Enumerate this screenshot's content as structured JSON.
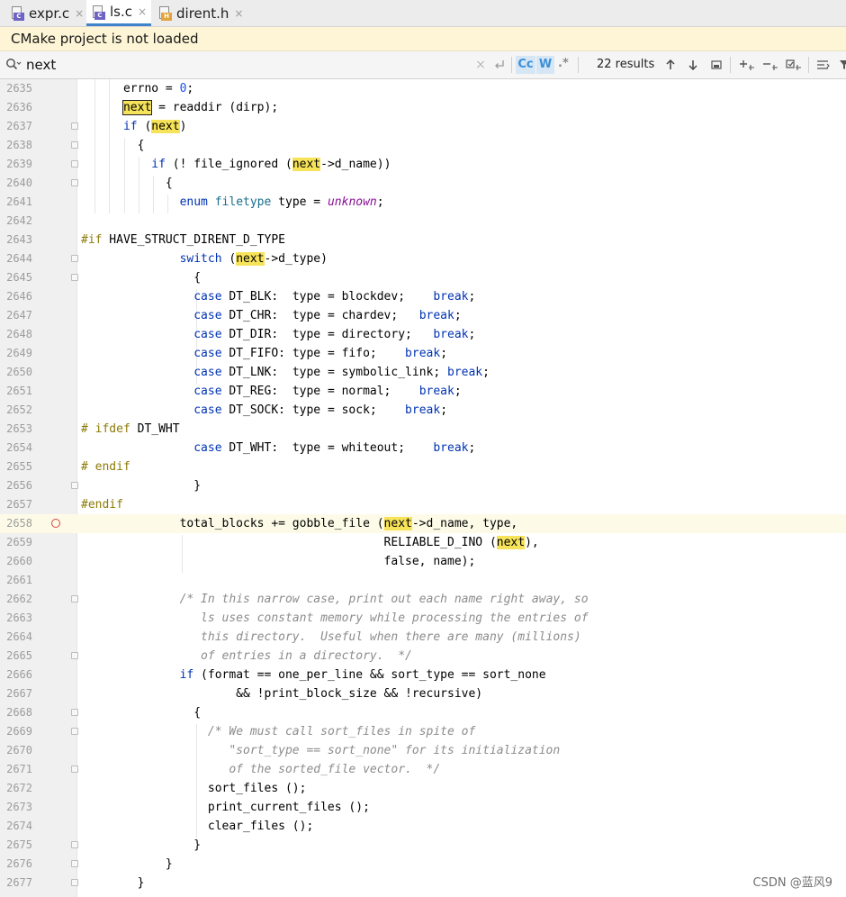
{
  "tabs": [
    {
      "label": "expr.c",
      "badge": "C",
      "badge_color": "#6e62c4",
      "active": false
    },
    {
      "label": "ls.c",
      "badge": "C",
      "badge_color": "#6e62c4",
      "active": true
    },
    {
      "label": "dirent.h",
      "badge": "H",
      "badge_color": "#e2a33a",
      "active": false
    }
  ],
  "tab_close_glyph": "×",
  "banner": {
    "text": "CMake project is not loaded"
  },
  "search": {
    "query": "next",
    "match_case_label": "Cc",
    "words_label": "W",
    "regex_label": ".*",
    "results": "22 results"
  },
  "editor": {
    "current_line": "2658",
    "breakpoint_line": "2658"
  },
  "watermark": "CSDN @蓝风9",
  "colors": {
    "highlight": "#f6e359",
    "keyword": "#0033b3",
    "preprocessor": "#8d7b07",
    "banner_bg": "#fdf5d5"
  }
}
